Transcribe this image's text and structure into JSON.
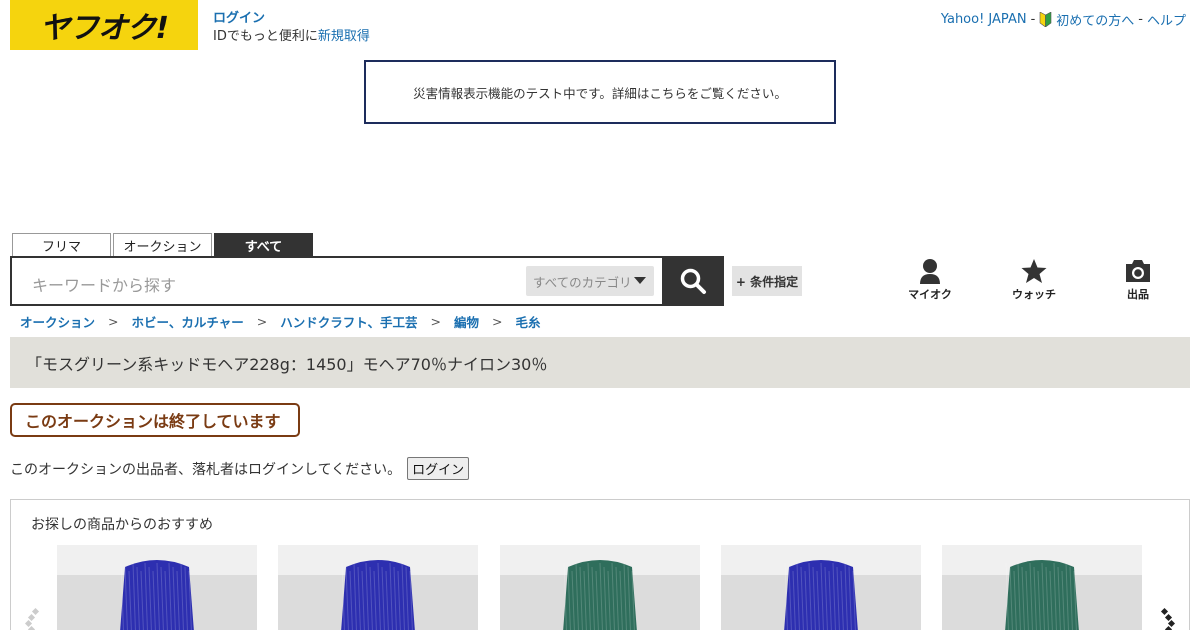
{
  "header": {
    "logo_text": "ヤフオク!",
    "login_label": "ログイン",
    "login_sub": "IDでもっと便利に",
    "signup_label": "新規取得",
    "yahoo_japan": "Yahoo! JAPAN",
    "beginner_label": "初めての方へ",
    "help_label": "ヘルプ",
    "sep": "-"
  },
  "notice": {
    "text_before": "災害情報表示機能のテスト中です。詳細は",
    "link": "こちら",
    "text_after": "をご覧ください。"
  },
  "search": {
    "tabs": [
      "フリマ",
      "オークション",
      "すべて"
    ],
    "placeholder": "キーワードから探す",
    "category": "すべてのカテゴリ",
    "condition_label": "+ 条件指定"
  },
  "nav": {
    "myauction": "マイオク",
    "watch": "ウォッチ",
    "sell": "出品"
  },
  "breadcrumb": [
    "オークション",
    "ホビー、カルチャー",
    "ハンドクラフト、手工芸",
    "編物",
    "毛糸"
  ],
  "breadcrumb_sep": ">",
  "item_title": "「モスグリーン系キッドモヘア228g：1450」モヘア70％ナイロン30％",
  "ended_label": "このオークションは終了しています",
  "login_note": "このオークションの出品者、落札者はログインしてください。",
  "login_button": "ログイン",
  "recommend": {
    "title": "お探しの商品からのおすすめ",
    "items": [
      {
        "color": "#2d2fb0"
      },
      {
        "color": "#2d2fb0"
      },
      {
        "color": "#2f6e5c"
      },
      {
        "color": "#2d2fb0"
      },
      {
        "color": "#2f6e5c"
      }
    ]
  },
  "colors": {
    "logo_bg": "#f5d40e",
    "link": "#1a6fb0",
    "ended": "#7a3b13",
    "title_bg": "#e1e0da"
  }
}
